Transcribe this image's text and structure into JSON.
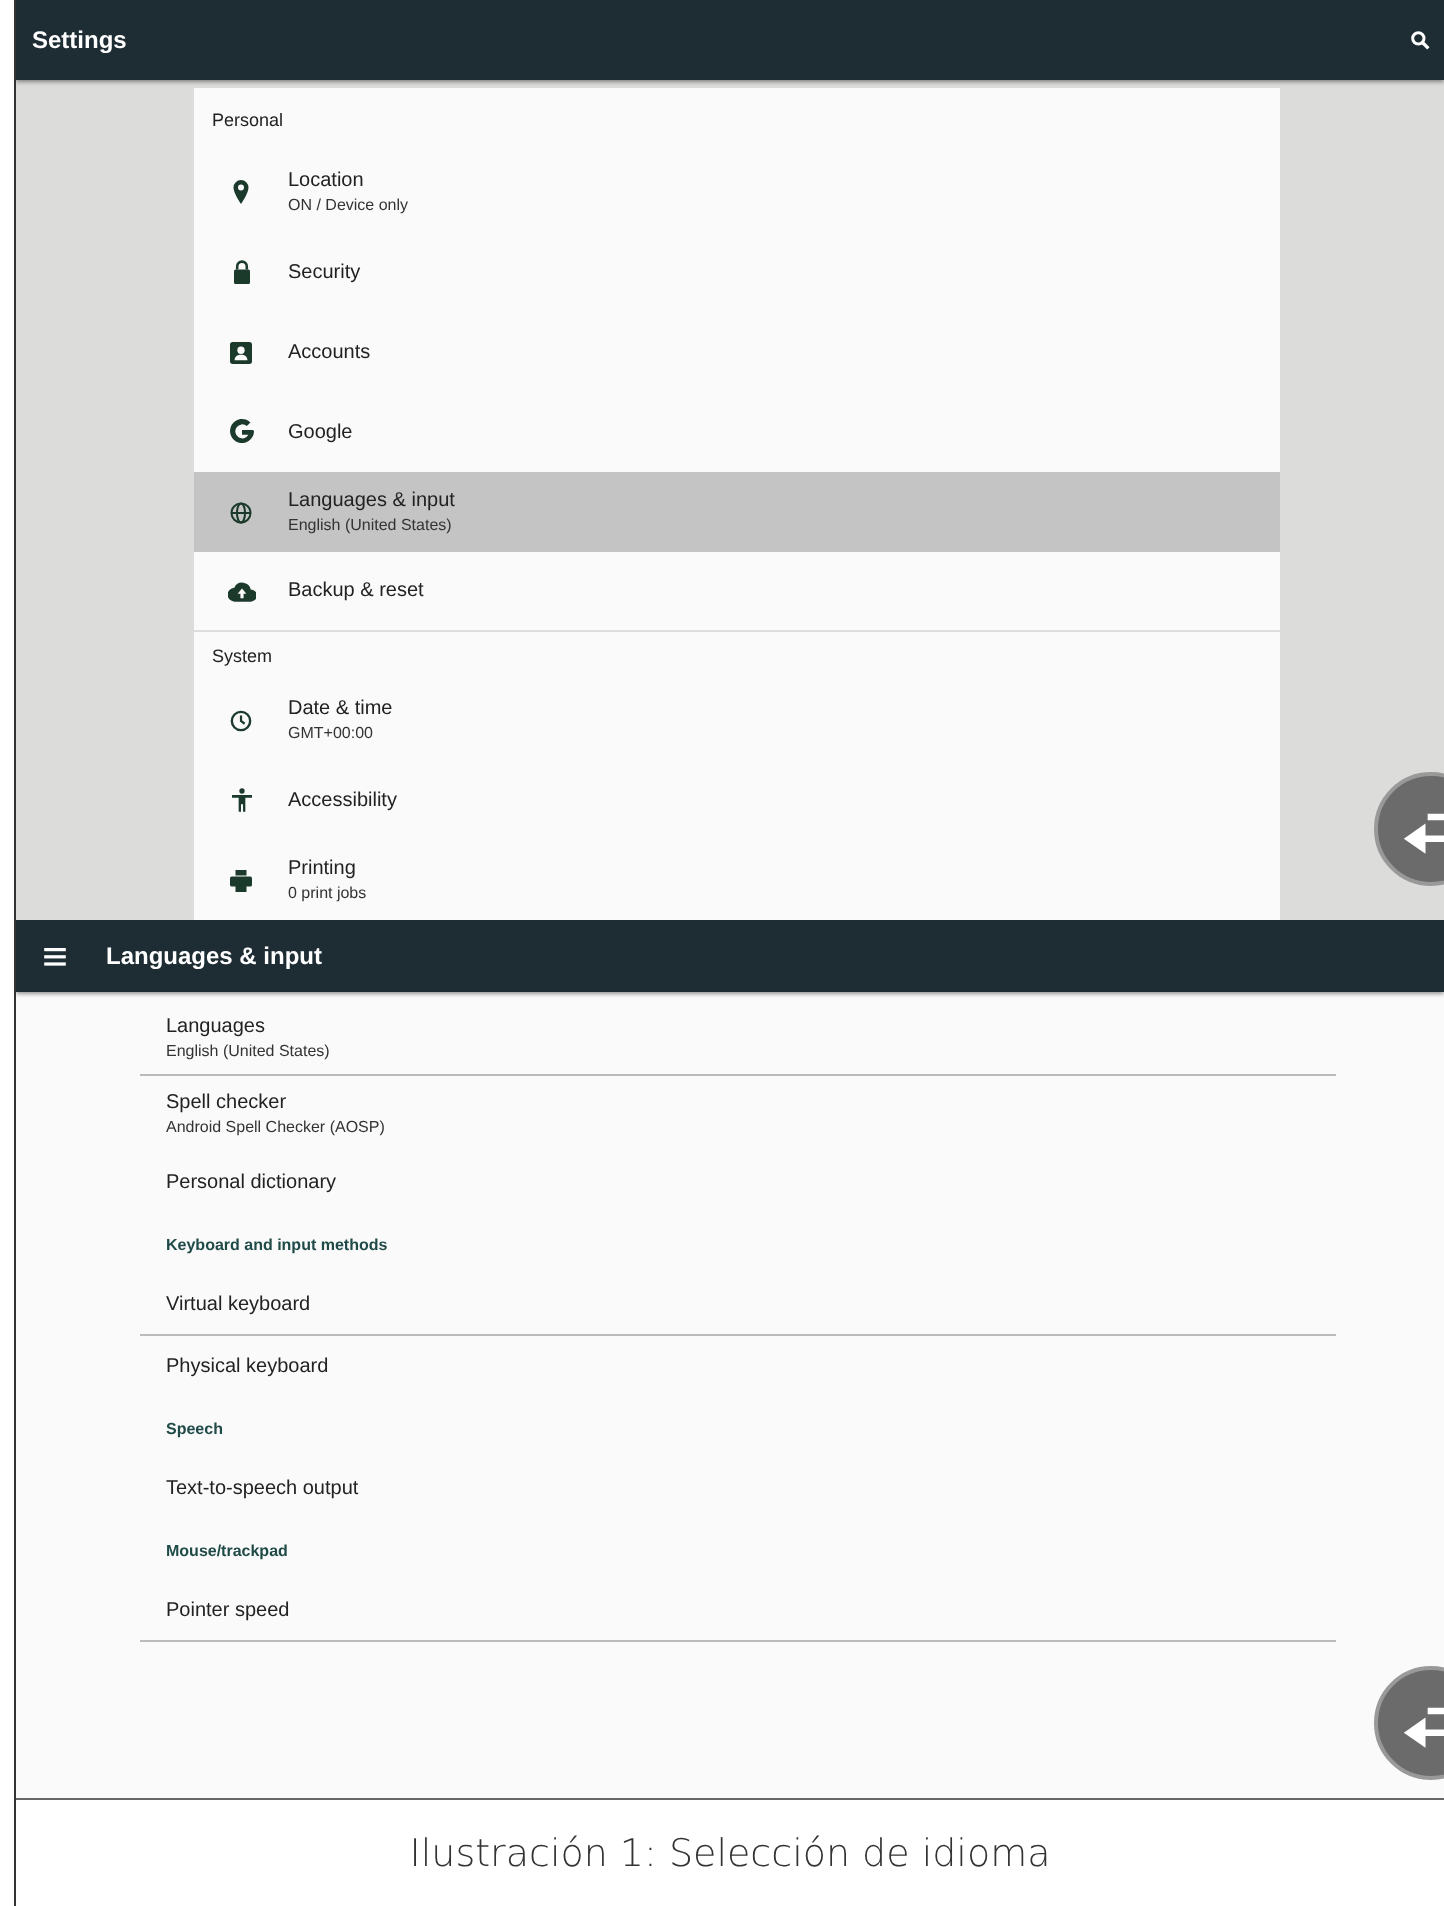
{
  "settings_screen": {
    "title": "Settings",
    "items": [
      {
        "kind": "header",
        "title": "Personal",
        "divider": false
      },
      {
        "kind": "item",
        "title": "Location",
        "subtitle": "ON / Device only",
        "selected": false,
        "divider": false
      },
      {
        "kind": "item",
        "title": "Security",
        "selected": false,
        "divider": false
      },
      {
        "kind": "item",
        "title": "Accounts",
        "selected": false,
        "divider": false
      },
      {
        "kind": "item",
        "title": "Google",
        "selected": false,
        "divider": false
      },
      {
        "kind": "item",
        "title": "Languages & input",
        "subtitle": "English (United States)",
        "selected": true,
        "divider": false
      },
      {
        "kind": "item",
        "title": "Backup & reset",
        "selected": false,
        "divider": true
      },
      {
        "kind": "header",
        "title": "System",
        "divider": false
      },
      {
        "kind": "item",
        "title": "Date & time",
        "subtitle": "GMT+00:00",
        "selected": false,
        "divider": false
      },
      {
        "kind": "item",
        "title": "Accessibility",
        "selected": false,
        "divider": false
      },
      {
        "kind": "item",
        "title": "Printing",
        "subtitle": "0 print jobs",
        "selected": false,
        "divider": false
      }
    ]
  },
  "languages_screen": {
    "title": "Languages & input",
    "items": [
      {
        "kind": "item",
        "title": "Languages",
        "subtitle": "English (United States)",
        "divider": true
      },
      {
        "kind": "item",
        "title": "Spell checker",
        "subtitle": "Android Spell Checker (AOSP)",
        "divider": false
      },
      {
        "kind": "item",
        "title": "Personal dictionary",
        "divider": false
      },
      {
        "kind": "header",
        "title": "Keyboard and input methods",
        "divider": false
      },
      {
        "kind": "item",
        "title": "Virtual keyboard",
        "divider": true
      },
      {
        "kind": "item",
        "title": "Physical keyboard",
        "divider": false
      },
      {
        "kind": "header",
        "title": "Speech",
        "divider": false
      },
      {
        "kind": "item",
        "title": "Text-to-speech output",
        "divider": false
      },
      {
        "kind": "header",
        "title": "Mouse/trackpad",
        "divider": false
      },
      {
        "kind": "item",
        "title": "Pointer speed",
        "divider": true
      }
    ]
  },
  "caption": "Ilustración 1: Selección de idioma"
}
